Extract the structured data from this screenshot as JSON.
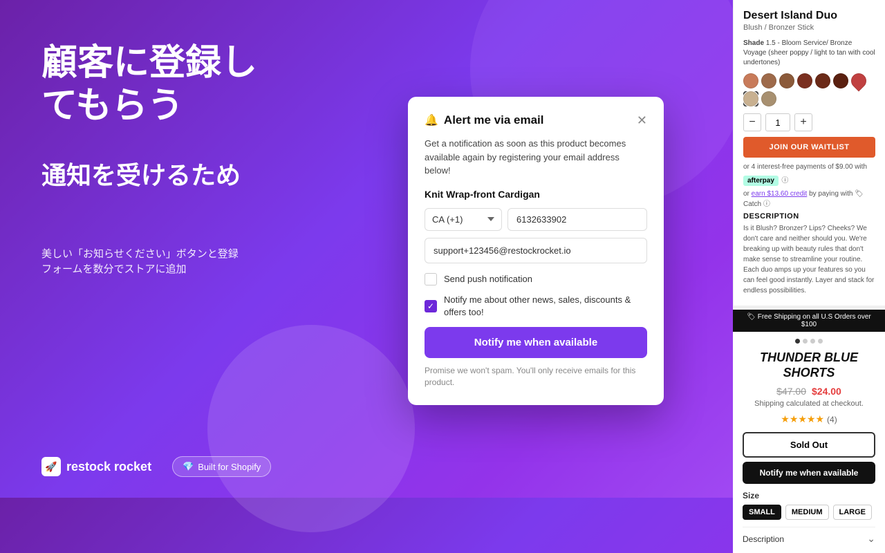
{
  "background": {
    "gradient_start": "#6b21a8",
    "gradient_end": "#a855f7"
  },
  "left": {
    "main_title": "顧客に登録し\nてもらう",
    "sub_title": "通知を受けるため",
    "description": "美しい「お知らせください」ボタンと登録\nフォームを数分でストアに追加"
  },
  "brand": {
    "logo_icon": "🚀",
    "logo_text": "restock rocket",
    "shopify_icon": "💎",
    "shopify_text": "Built for Shopify"
  },
  "modal": {
    "title": "Alert me via email",
    "bell_icon": "🔔",
    "description": "Get a notification as soon as this product becomes available again by registering your email address below!",
    "product_name": "Knit Wrap-front Cardigan",
    "phone_country": "CA (+1)",
    "phone_number": "6132633902",
    "email_value": "support+123456@restockrocket.io",
    "checkbox_push_label": "Send push notification",
    "checkbox_push_checked": false,
    "checkbox_news_label": "Notify me about other news, sales, discounts & offers too!",
    "checkbox_news_checked": true,
    "notify_button": "Notify me when available",
    "spam_text": "Promise we won't spam. You'll only receive emails for this product."
  },
  "panel_top": {
    "title": "Desert Island Duo",
    "subtitle": "Blush / Bronzer Stick",
    "shade_label": "Shade",
    "shade_value": "1.5 - Bloom Service/ Bronze Voyage (sheer poppy / light to tan with cool undertones)",
    "swatches": [
      {
        "color": "#c87b5a",
        "selected": false
      },
      {
        "color": "#9e5a3a",
        "selected": false
      },
      {
        "color": "#8b4a2a",
        "selected": false
      },
      {
        "color": "#7a3020",
        "selected": false
      },
      {
        "color": "#6b2010",
        "selected": false
      },
      {
        "color": "#5a1a0a",
        "selected": false
      },
      {
        "color": "#c05050",
        "selected": false
      },
      {
        "color": "#c8b090",
        "selected": true
      },
      {
        "color": "#a89070",
        "selected": false
      }
    ],
    "qty": "1",
    "waitlist_btn": "JOIN OUR WAITLIST",
    "afterpay_text": "or 4 interest-free payments of $9.00 with",
    "afterpay_badge": "afterpay",
    "catch_text": "or earn $13.60 credit by paying with",
    "desc_heading": "DESCRIPTION",
    "desc_text": "Is it Blush? Bronzer? Lips? Cheeks? We don't care and neither should you. We're breaking up with beauty rules that don't make sense to streamline your routine. Each duo amps up your features so you can feel good instantly. Layer and stack for endless possibilities."
  },
  "panel_bottom": {
    "shipping_banner": "🏷 Free Shipping on all U.S Orders over $100",
    "dots": [
      true,
      false,
      false,
      false
    ],
    "product_name": "THUNDER BLUE\nSHORTS",
    "price_original": "$47.00",
    "price_sale": "$24.00",
    "shipping_note": "Shipping calculated at checkout.",
    "stars": "★★★★★",
    "review_count": "(4)",
    "sold_out_btn": "Sold Out",
    "notify_btn": "Notify me when available",
    "size_label": "Size",
    "sizes": [
      {
        "label": "SMALL",
        "active": true
      },
      {
        "label": "MEDIUM",
        "active": false
      },
      {
        "label": "LARGE",
        "active": false
      }
    ],
    "description_label": "Description"
  }
}
